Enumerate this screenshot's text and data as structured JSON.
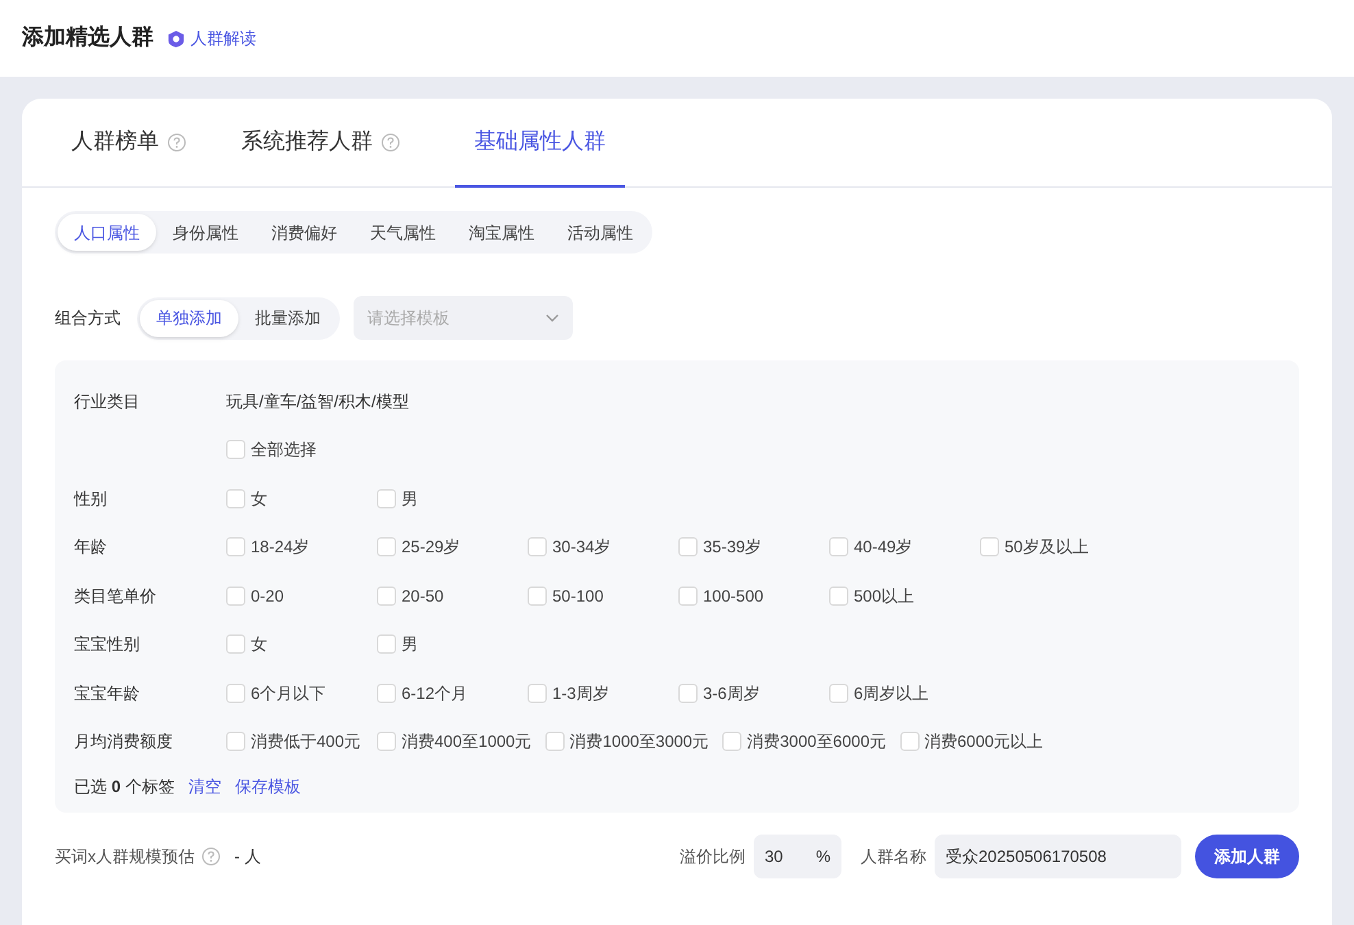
{
  "header": {
    "title": "添加精选人群",
    "link": "人群解读"
  },
  "tabs": [
    {
      "label": "人群榜单",
      "help": true,
      "selected": false
    },
    {
      "label": "系统推荐人群",
      "help": true,
      "selected": false
    },
    {
      "label": "基础属性人群",
      "help": false,
      "selected": true
    }
  ],
  "subtabs": [
    {
      "label": "人口属性",
      "selected": true
    },
    {
      "label": "身份属性",
      "selected": false
    },
    {
      "label": "消费偏好",
      "selected": false
    },
    {
      "label": "天气属性",
      "selected": false
    },
    {
      "label": "淘宝属性",
      "selected": false
    },
    {
      "label": "活动属性",
      "selected": false
    }
  ],
  "combine": {
    "label": "组合方式",
    "modes": [
      {
        "label": "单独添加",
        "selected": true
      },
      {
        "label": "批量添加",
        "selected": false
      }
    ],
    "template": {
      "placeholder": "请选择模板"
    }
  },
  "filters": [
    {
      "kind": "text",
      "label": "行业类目",
      "value": "玩具/童车/益智/积木/模型"
    },
    {
      "kind": "checkboxes",
      "options": [
        {
          "label": "全部选择",
          "checked": false
        }
      ]
    },
    {
      "kind": "checkboxes",
      "label": "性别",
      "options": [
        {
          "label": "女",
          "checked": false
        },
        {
          "label": "男",
          "checked": false
        }
      ]
    },
    {
      "kind": "checkboxes",
      "label": "年龄",
      "options": [
        {
          "label": "18-24岁",
          "checked": false
        },
        {
          "label": "25-29岁",
          "checked": false
        },
        {
          "label": "30-34岁",
          "checked": false
        },
        {
          "label": "35-39岁",
          "checked": false
        },
        {
          "label": "40-49岁",
          "checked": false
        },
        {
          "label": "50岁及以上",
          "checked": false
        }
      ]
    },
    {
      "kind": "checkboxes",
      "label": "类目笔单价",
      "options": [
        {
          "label": "0-20",
          "checked": false
        },
        {
          "label": "20-50",
          "checked": false
        },
        {
          "label": "50-100",
          "checked": false
        },
        {
          "label": "100-500",
          "checked": false
        },
        {
          "label": "500以上",
          "checked": false
        }
      ]
    },
    {
      "kind": "checkboxes",
      "label": "宝宝性别",
      "options": [
        {
          "label": "女",
          "checked": false
        },
        {
          "label": "男",
          "checked": false
        }
      ]
    },
    {
      "kind": "checkboxes",
      "label": "宝宝年龄",
      "options": [
        {
          "label": "6个月以下",
          "checked": false
        },
        {
          "label": "6-12个月",
          "checked": false
        },
        {
          "label": "1-3周岁",
          "checked": false
        },
        {
          "label": "3-6周岁",
          "checked": false
        },
        {
          "label": "6周岁以上",
          "checked": false
        }
      ]
    },
    {
      "kind": "checkboxes",
      "label": "月均消费额度",
      "options": [
        {
          "label": "消费低于400元",
          "checked": false
        },
        {
          "label": "消费400至1000元",
          "checked": false
        },
        {
          "label": "消费1000至3000元",
          "checked": false
        },
        {
          "label": "消费3000至6000元",
          "checked": false
        },
        {
          "label": "消费6000元以上",
          "checked": false
        }
      ]
    }
  ],
  "summary": {
    "text": "已选 **0** 个标签",
    "clear": "清空",
    "save": "保存模板"
  },
  "footer": {
    "estimate_label": "买词x人群规模预估",
    "estimate_value": "- 人",
    "premium_label": "溢价比例",
    "premium_value": "30",
    "premium_unit": "%",
    "name_label": "人群名称",
    "name_value": "受众20250506170508",
    "submit": "添加人群"
  }
}
